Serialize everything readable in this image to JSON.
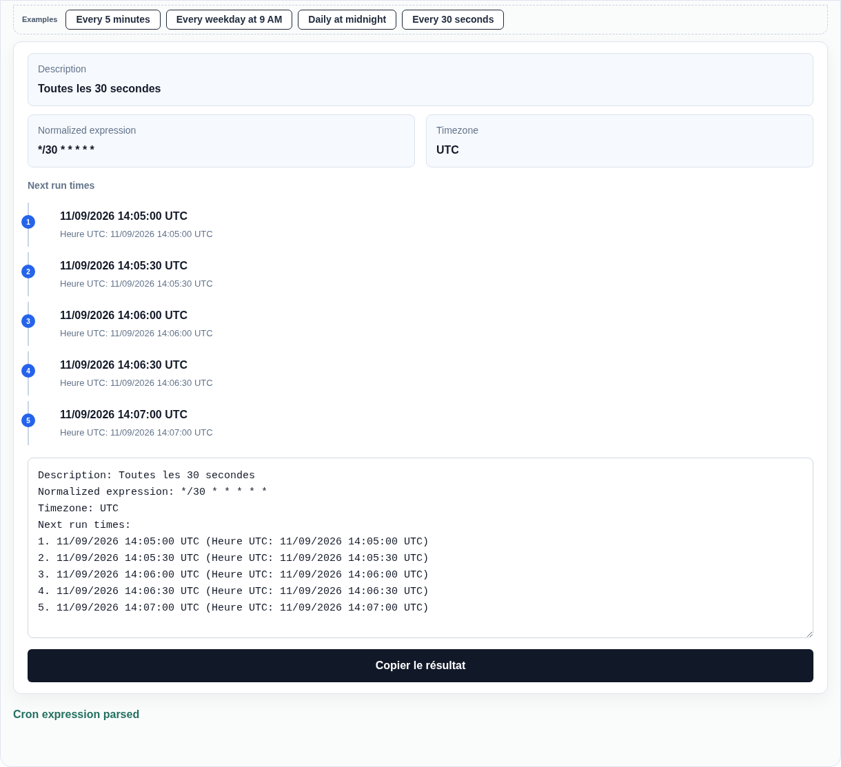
{
  "examples": {
    "label": "Examples",
    "items": [
      "Every 5 minutes",
      "Every weekday at 9 AM",
      "Daily at midnight",
      "Every 30 seconds"
    ]
  },
  "description": {
    "label": "Description",
    "value": "Toutes les 30 secondes"
  },
  "normalized": {
    "label": "Normalized expression",
    "value": "*/30 * * * * *"
  },
  "timezone": {
    "label": "Timezone",
    "value": "UTC"
  },
  "next_runs": {
    "title": "Next run times",
    "items": [
      {
        "number": "1",
        "time": "11/09/2026 14:05:00 UTC",
        "detail": "Heure UTC: 11/09/2026 14:05:00 UTC"
      },
      {
        "number": "2",
        "time": "11/09/2026 14:05:30 UTC",
        "detail": "Heure UTC: 11/09/2026 14:05:30 UTC"
      },
      {
        "number": "3",
        "time": "11/09/2026 14:06:00 UTC",
        "detail": "Heure UTC: 11/09/2026 14:06:00 UTC"
      },
      {
        "number": "4",
        "time": "11/09/2026 14:06:30 UTC",
        "detail": "Heure UTC: 11/09/2026 14:06:30 UTC"
      },
      {
        "number": "5",
        "time": "11/09/2026 14:07:00 UTC",
        "detail": "Heure UTC: 11/09/2026 14:07:00 UTC"
      }
    ]
  },
  "output": "Description: Toutes les 30 secondes\nNormalized expression: */30 * * * * *\nTimezone: UTC\nNext run times:\n1. 11/09/2026 14:05:00 UTC (Heure UTC: 11/09/2026 14:05:00 UTC)\n2. 11/09/2026 14:05:30 UTC (Heure UTC: 11/09/2026 14:05:30 UTC)\n3. 11/09/2026 14:06:00 UTC (Heure UTC: 11/09/2026 14:06:00 UTC)\n4. 11/09/2026 14:06:30 UTC (Heure UTC: 11/09/2026 14:06:30 UTC)\n5. 11/09/2026 14:07:00 UTC (Heure UTC: 11/09/2026 14:07:00 UTC)",
  "copy_button": "Copier le résultat",
  "status": "Cron expression parsed"
}
